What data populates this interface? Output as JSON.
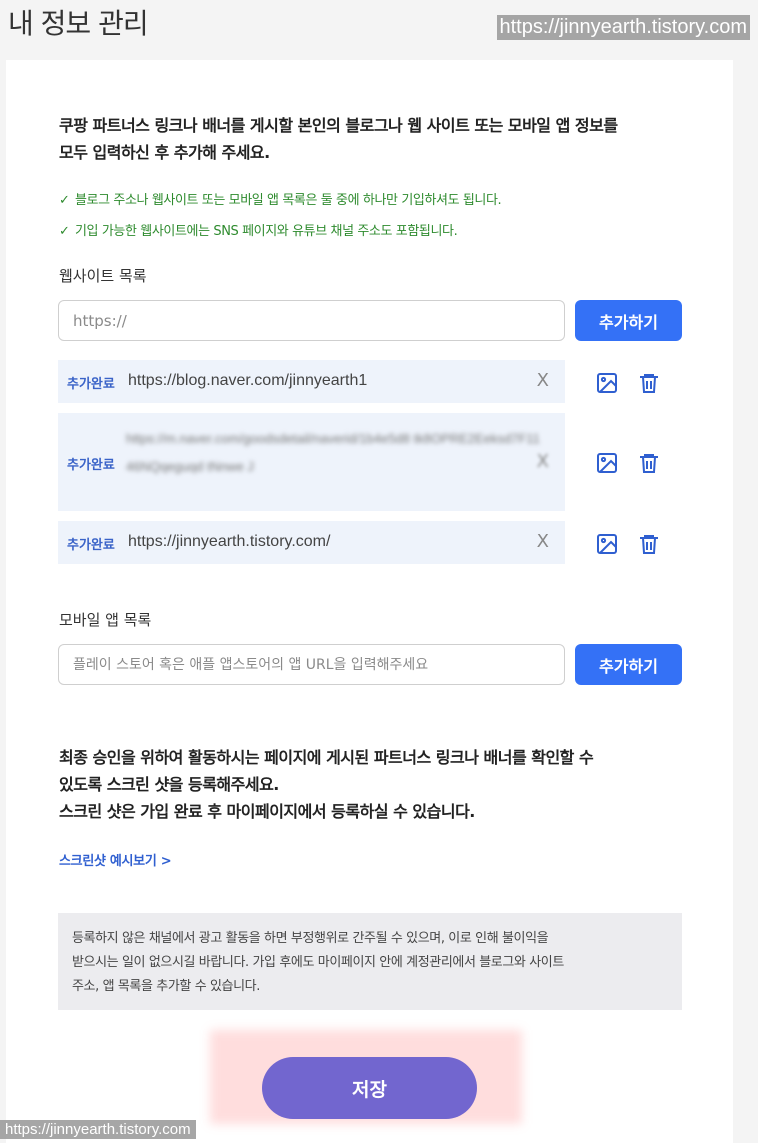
{
  "page": {
    "title": "내 정보 관리",
    "watermark": "https://jinnyearth.tistory.com"
  },
  "intro": {
    "line1": "쿠팡 파트너스 링크나 배너를 게시할 본인의 블로그나 웹 사이트 또는 모바일 앱 정보를",
    "line2": "모두 입력하신 후 추가해 주세요.",
    "check_mark": "✓",
    "notes": [
      "블로그 주소나 웹사이트 또는 모바일 앱 목록은 둘 중에 하나만 기입하셔도 됩니다.",
      "기입 가능한 웹사이트에는 SNS 페이지와 유튜브 채널 주소도 포함됩니다."
    ]
  },
  "website_section": {
    "label": "웹사이트 목록",
    "input_placeholder": "https://",
    "add_button": "추가하기",
    "entries": [
      {
        "badge": "추가완료",
        "url": "https://blog.naver.com/jinnyearth1",
        "remove": "X"
      },
      {
        "badge": "추가완료",
        "url": "https://m.naver.com/goodsdetail/naverid/1b4e5d8 tk8OPRE2Eeksd7F1146NQqeguqd tNnwe J",
        "remove": "X"
      },
      {
        "badge": "추가완료",
        "url": "https://jinnyearth.tistory.com/",
        "remove": "X"
      }
    ]
  },
  "app_section": {
    "label": "모바일 앱 목록",
    "input_placeholder": "플레이 스토어 혹은 애플 앱스토어의 앱 URL을 입력해주세요",
    "add_button": "추가하기"
  },
  "screenshot_notice": {
    "line1": "최종 승인을 위하여 활동하시는 페이지에 게시된 파트너스 링크나 배너를 확인할 수",
    "line2": "있도록 스크린 샷을 등록해주세요.",
    "line3": "스크린 샷은 가입 완료 후 마이페이지에서 등록하실 수 있습니다.",
    "example_link": "스크린샷 예시보기 >"
  },
  "info_box": {
    "line1": "등록하지 않은 채널에서 광고 활동을 하면 부정행위로 간주될 수 있으며, 이로 인해 불이익을",
    "line2": "받으시는 일이 없으시길 바랍니다. 가입 후에도 마이페이지 안에 계정관리에서 블로그와 사이트",
    "line3": "주소, 앱 목록을 추가할 수 있습니다."
  },
  "save_button": "저장",
  "colors": {
    "primary_blue": "#3471f6",
    "save_purple": "#7266cf",
    "check_green": "#2e8b2e",
    "row_bg": "#eef3fb"
  },
  "icons": {
    "image": "image-icon",
    "trash": "trash-icon",
    "close": "close-icon"
  }
}
